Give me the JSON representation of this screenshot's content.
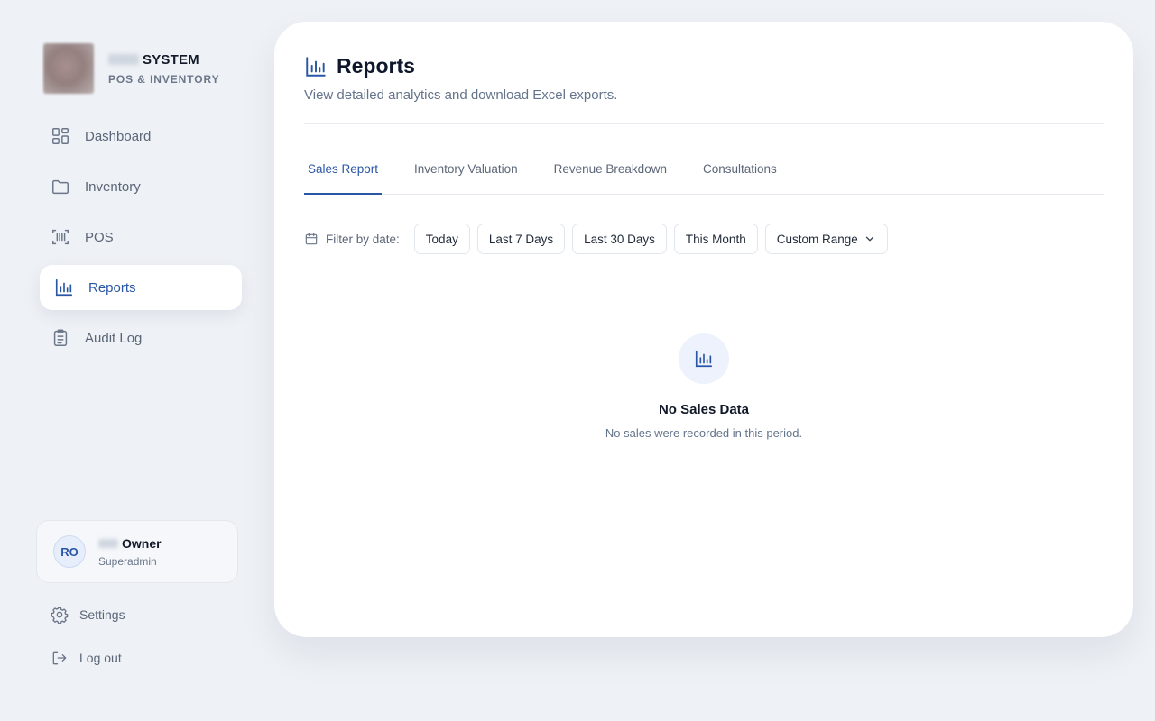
{
  "brand": {
    "title": "SYSTEM",
    "subtitle": "POS & INVENTORY"
  },
  "sidebar": {
    "items": [
      {
        "label": "Dashboard",
        "icon": "dashboard-grid-icon"
      },
      {
        "label": "Inventory",
        "icon": "folder-icon"
      },
      {
        "label": "POS",
        "icon": "barcode-scan-icon"
      },
      {
        "label": "Reports",
        "icon": "bar-chart-icon",
        "active": true
      },
      {
        "label": "Audit Log",
        "icon": "clipboard-list-icon"
      }
    ]
  },
  "user": {
    "initials": "RO",
    "name": "Owner",
    "role": "Superadmin"
  },
  "bottom": {
    "settings": "Settings",
    "logout": "Log out"
  },
  "page": {
    "title": "Reports",
    "subtitle": "View detailed analytics and download Excel exports."
  },
  "tabs": [
    {
      "label": "Sales Report",
      "active": true
    },
    {
      "label": "Inventory Valuation"
    },
    {
      "label": "Revenue Breakdown"
    },
    {
      "label": "Consultations"
    }
  ],
  "filters": {
    "label": "Filter by date:",
    "options": [
      "Today",
      "Last 7 Days",
      "Last 30 Days",
      "This Month"
    ],
    "custom": "Custom Range"
  },
  "empty_state": {
    "title": "No Sales Data",
    "message": "No sales were recorded in this period."
  },
  "colors": {
    "accent": "#2a56a6",
    "background": "#eef1f5",
    "surface": "#ffffff"
  }
}
